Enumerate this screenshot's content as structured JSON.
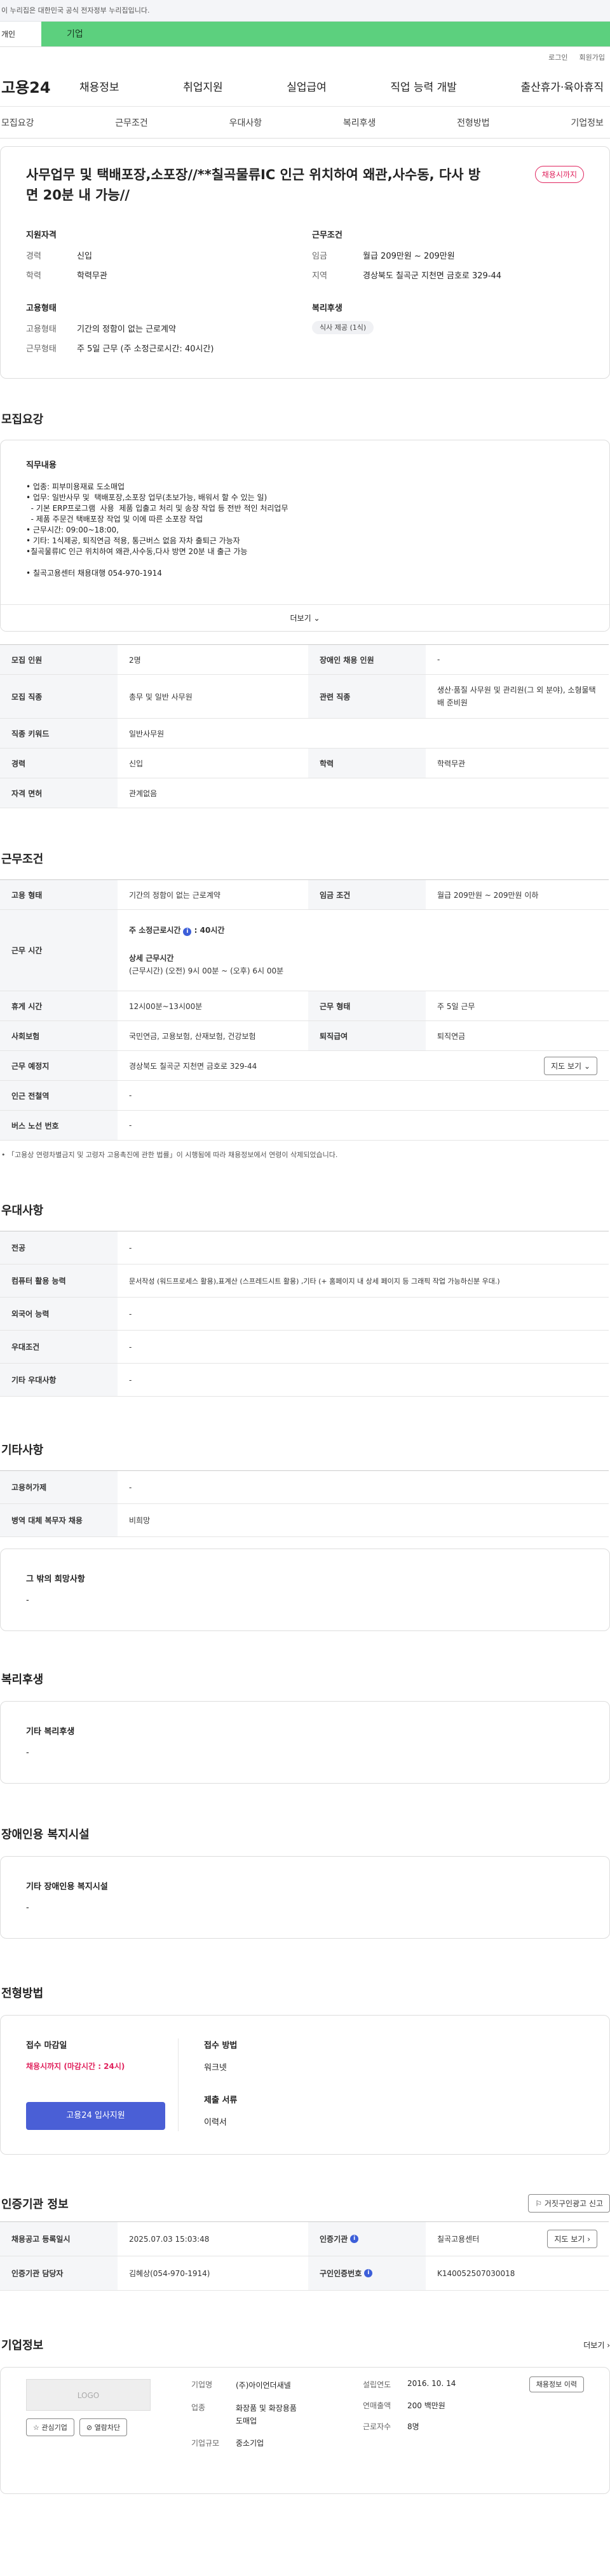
{
  "gov_banner": "이 누리집은 대한민국 공식 전자정부 누리집입니다.",
  "tabs": {
    "personal": "개인",
    "enterprise": "기업"
  },
  "util": {
    "login": "로그인",
    "signup": "회원가입"
  },
  "logo": "고용24",
  "gnb": [
    "채용정보",
    "취업지원",
    "실업급여",
    "직업 능력 개발",
    "출산휴가·육아휴직"
  ],
  "subnav": [
    "모집요강",
    "근무조건",
    "우대사항",
    "복리후생",
    "전형방법",
    "기업정보"
  ],
  "summary": {
    "title": "사무업무 및 택배포장,소포장//**칠곡물류IC 인근 위치하여 왜관,사수동, 다사 방면 20분 내 가능//",
    "badge": "채용시까지",
    "qual_heading": "지원자격",
    "career_l": "경력",
    "career_v": "신입",
    "edu_l": "학력",
    "edu_v": "학력무관",
    "emp_heading": "고용형태",
    "emptype_l": "고용형태",
    "emptype_v": "기간의 정함이 없는 근로계약",
    "worktype_l": "근무형태",
    "worktype_v": "주 5일 근무 (주 소정근로시간: 40시간)",
    "cond_heading": "근무조건",
    "wage_l": "임금",
    "wage_v": "월급 209만원 ~ 209만원",
    "loc_l": "지역",
    "loc_v": "경상북도 칠곡군 지천면 금호로 329-44",
    "welfare_heading": "복리후생",
    "welfare_chip": "식사 제공 (1식)"
  },
  "recruit": {
    "title": "모집요강",
    "duty_heading": "직무내용",
    "duty_lines": [
      "• 업종: 피부미용재료 도소매업",
      "• 업무: 일반사무 및  택배포장,소포장 업무(초보가능, 배워서 할 수 있는 일)",
      "  - 기본 ERP프로그램  사용  제품 입출고 처리 및 송장 작업 등 전반 적인 처리업무",
      "  - 제품 주문건 택배포장 작업 및 이에 따른 소포장 작업",
      "• 근무시간: 09:00~18:00,",
      "• 기타: 1식제공, 퇴직연금 적용, 통근버스 없음 자차 출퇴근 가능자",
      "•칠곡물류IC 인근 위치하여 왜관,사수동,다사 방면 20분 내 출근 가능",
      "",
      "• 칠곡고용센터 채용대행 054-970-1914"
    ],
    "more": "더보기",
    "rows": [
      [
        "모집 인원",
        "2명",
        "장애인 채용 인원",
        "-"
      ],
      [
        "모집 직종",
        "총무 및 일반 사무원",
        "관련 직종",
        "생산·품질 사무원 및 관리원(그 외 분야), 소형물택배 준비원"
      ],
      [
        "직종 키워드",
        "일반사무원"
      ],
      [
        "경력",
        "신입",
        "학력",
        "학력무관"
      ],
      [
        "자격 면허",
        "관계없음"
      ]
    ]
  },
  "work": {
    "title": "근무조건",
    "r1": [
      "고용 형태",
      "기간의 정함이 없는 근로계약",
      "임금 조건",
      "월급 209만원 ~ 209만원 이하"
    ],
    "time_l": "근무 시간",
    "time_total": "주 소정근로시간",
    "time_hours": "40시간",
    "time_detail_h": "상세 근무시간",
    "time_detail": "(근무시간) (오전) 9시 00분 ~ (오후) 6시 00분",
    "r3": [
      "휴게 시간",
      "12시00분~13시00분",
      "근무 형태",
      "주 5일 근무"
    ],
    "r4": [
      "사회보험",
      "국민연금, 고용보험, 산재보험, 건강보험",
      "퇴직급여",
      "퇴직연금"
    ],
    "addr_l": "근무 예정지",
    "addr_v": "경상북도 칠곡군 지천면 금호로 329-44",
    "map_btn": "지도 보기",
    "r6": [
      "인근 전철역",
      "-"
    ],
    "r7": [
      "버스 노선 번호",
      "-"
    ],
    "note": "「고용상 연령차별금지 및 고령자 고용촉진에 관한 법률」이 시행됨에 따라 채용정보에서 연령이 삭제되었습니다."
  },
  "pref": {
    "title": "우대사항",
    "rows": [
      [
        "전공",
        "-"
      ],
      [
        "컴퓨터 활용 능력",
        "문서작성 (워드프로세스 활용),표계산 (스프레드시트 활용) ,기타 (+ 홈페이지 내 상세 페이지 등 그래픽 작업 가능하신분 우대.)"
      ],
      [
        "외국어 능력",
        "-"
      ],
      [
        "우대조건",
        "-"
      ],
      [
        "기타 우대사항",
        "-"
      ]
    ]
  },
  "etc": {
    "title": "기타사항",
    "rows": [
      [
        "고용허가제",
        "-"
      ],
      [
        "병역 대체 복무자 채용",
        "비희망"
      ]
    ],
    "other_h": "그 밖의 희망사항",
    "other_v": "-"
  },
  "benefit": {
    "title": "복리후생",
    "h": "기타 복리후생",
    "v": "-"
  },
  "disabled": {
    "title": "장애인용 복지시설",
    "h": "기타 장애인용 복지시설",
    "v": "-"
  },
  "selection": {
    "title": "전형방법",
    "deadline_h": "접수 마감일",
    "deadline_v": "채용시까지 (마감시간 : 24시)",
    "apply_btn": "고용24 입사지원",
    "method_h": "접수 방법",
    "method_v": "워크넷",
    "docs_h": "제출 서류",
    "docs_v": "이력서"
  },
  "cert": {
    "title": "인증기관 정보",
    "report_btn": "거짓구인광고 신고",
    "rows": [
      [
        "채용공고 등록일시",
        "2025.07.03 15:03:48",
        "인증기관",
        "칠곡고용센터"
      ],
      [
        "인증기관 담당자",
        "김혜상(054-970-1914)",
        "구인인증번호",
        "K140052507030018"
      ]
    ],
    "map_btn": "지도 보기"
  },
  "company": {
    "title": "기업정보",
    "more": "더보기",
    "logo": "LOGO",
    "fav_btn": "관심기업",
    "block_btn": "열람차단",
    "name_l": "기업명",
    "name_v": "(주)아이언더새넬",
    "industry_l": "업종",
    "industry_v": "화장품 및 화장용품 도매업",
    "size_l": "기업규모",
    "size_v": "중소기업",
    "found_l": "설립연도",
    "found_v": "2016. 10. 14",
    "sales_l": "연매출액",
    "sales_v": "200 백만원",
    "emp_l": "근로자수",
    "emp_v": "8명",
    "history_btn": "채용정보 이력"
  }
}
